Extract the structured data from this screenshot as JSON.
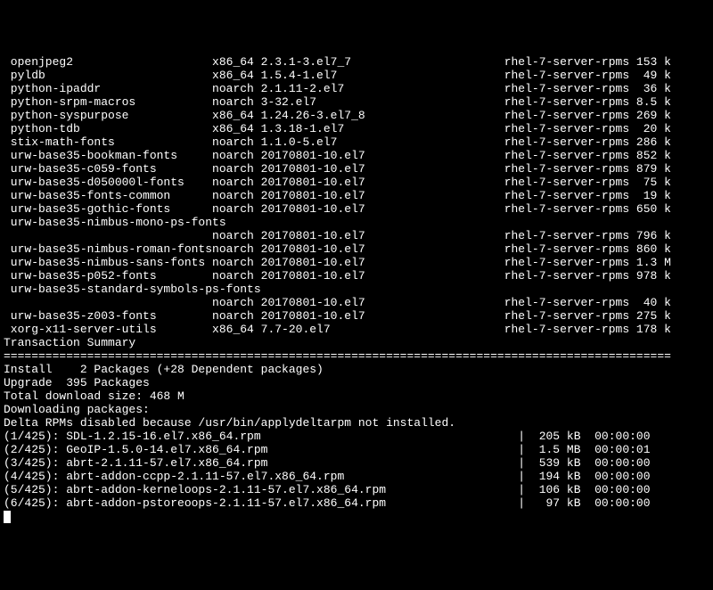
{
  "packages": [
    {
      "name": " openjpeg2",
      "arch": "x86_64",
      "ver": "2.3.1-3.el7_7",
      "repo": "rhel-7-server-rpms",
      "size": "153 k"
    },
    {
      "name": " pyldb",
      "arch": "x86_64",
      "ver": "1.5.4-1.el7",
      "repo": "rhel-7-server-rpms",
      "size": " 49 k"
    },
    {
      "name": " python-ipaddr",
      "arch": "noarch",
      "ver": "2.1.11-2.el7",
      "repo": "rhel-7-server-rpms",
      "size": " 36 k"
    },
    {
      "name": " python-srpm-macros",
      "arch": "noarch",
      "ver": "3-32.el7",
      "repo": "rhel-7-server-rpms",
      "size": "8.5 k"
    },
    {
      "name": " python-syspurpose",
      "arch": "x86_64",
      "ver": "1.24.26-3.el7_8",
      "repo": "rhel-7-server-rpms",
      "size": "269 k"
    },
    {
      "name": " python-tdb",
      "arch": "x86_64",
      "ver": "1.3.18-1.el7",
      "repo": "rhel-7-server-rpms",
      "size": " 20 k"
    },
    {
      "name": " stix-math-fonts",
      "arch": "noarch",
      "ver": "1.1.0-5.el7",
      "repo": "rhel-7-server-rpms",
      "size": "286 k"
    },
    {
      "name": " urw-base35-bookman-fonts",
      "arch": "noarch",
      "ver": "20170801-10.el7",
      "repo": "rhel-7-server-rpms",
      "size": "852 k"
    },
    {
      "name": " urw-base35-c059-fonts",
      "arch": "noarch",
      "ver": "20170801-10.el7",
      "repo": "rhel-7-server-rpms",
      "size": "879 k"
    },
    {
      "name": " urw-base35-d050000l-fonts",
      "arch": "noarch",
      "ver": "20170801-10.el7",
      "repo": "rhel-7-server-rpms",
      "size": " 75 k"
    },
    {
      "name": " urw-base35-fonts-common",
      "arch": "noarch",
      "ver": "20170801-10.el7",
      "repo": "rhel-7-server-rpms",
      "size": " 19 k"
    },
    {
      "name": " urw-base35-gothic-fonts",
      "arch": "noarch",
      "ver": "20170801-10.el7",
      "repo": "rhel-7-server-rpms",
      "size": "650 k"
    },
    {
      "name": " urw-base35-nimbus-mono-ps-fonts",
      "arch": "",
      "ver": "",
      "repo": "",
      "size": "",
      "wrap": true
    },
    {
      "name": "",
      "arch": "noarch",
      "ver": "20170801-10.el7",
      "repo": "rhel-7-server-rpms",
      "size": "796 k",
      "cont": true
    },
    {
      "name": " urw-base35-nimbus-roman-fonts",
      "arch": "noarch",
      "ver": "20170801-10.el7",
      "repo": "rhel-7-server-rpms",
      "size": "860 k"
    },
    {
      "name": " urw-base35-nimbus-sans-fonts",
      "arch": "noarch",
      "ver": "20170801-10.el7",
      "repo": "rhel-7-server-rpms",
      "size": "1.3 M"
    },
    {
      "name": " urw-base35-p052-fonts",
      "arch": "noarch",
      "ver": "20170801-10.el7",
      "repo": "rhel-7-server-rpms",
      "size": "978 k"
    },
    {
      "name": " urw-base35-standard-symbols-ps-fonts",
      "arch": "",
      "ver": "",
      "repo": "",
      "size": "",
      "wrap": true
    },
    {
      "name": "",
      "arch": "noarch",
      "ver": "20170801-10.el7",
      "repo": "rhel-7-server-rpms",
      "size": " 40 k",
      "cont": true
    },
    {
      "name": " urw-base35-z003-fonts",
      "arch": "noarch",
      "ver": "20170801-10.el7",
      "repo": "rhel-7-server-rpms",
      "size": "275 k"
    },
    {
      "name": " xorg-x11-server-utils",
      "arch": "x86_64",
      "ver": "7.7-20.el7",
      "repo": "rhel-7-server-rpms",
      "size": "178 k"
    }
  ],
  "blank": "",
  "summary": {
    "title": "Transaction Summary",
    "sep": "================================================================================================",
    "install": "Install    2 Packages (+28 Dependent packages)",
    "upgrade": "Upgrade  395 Packages"
  },
  "total": "Total download size: 468 M",
  "dlhdr": "Downloading packages:",
  "delta": "Delta RPMs disabled because /usr/bin/applydeltarpm not installed.",
  "downloads": [
    {
      "idx": "(1/425)",
      "file": "SDL-1.2.15-16.el7.x86_64.rpm",
      "size": "205 kB",
      "time": "00:00:00"
    },
    {
      "idx": "(2/425)",
      "file": "GeoIP-1.5.0-14.el7.x86_64.rpm",
      "size": "1.5 MB",
      "time": "00:00:01"
    },
    {
      "idx": "(3/425)",
      "file": "abrt-2.1.11-57.el7.x86_64.rpm",
      "size": "539 kB",
      "time": "00:00:00"
    },
    {
      "idx": "(4/425)",
      "file": "abrt-addon-ccpp-2.1.11-57.el7.x86_64.rpm",
      "size": "194 kB",
      "time": "00:00:00"
    },
    {
      "idx": "(5/425)",
      "file": "abrt-addon-kerneloops-2.1.11-57.el7.x86_64.rpm",
      "size": "106 kB",
      "time": "00:00:00"
    },
    {
      "idx": "(6/425)",
      "file": "abrt-addon-pstoreoops-2.1.11-57.el7.x86_64.rpm",
      "size": " 97 kB",
      "time": "00:00:00"
    }
  ]
}
